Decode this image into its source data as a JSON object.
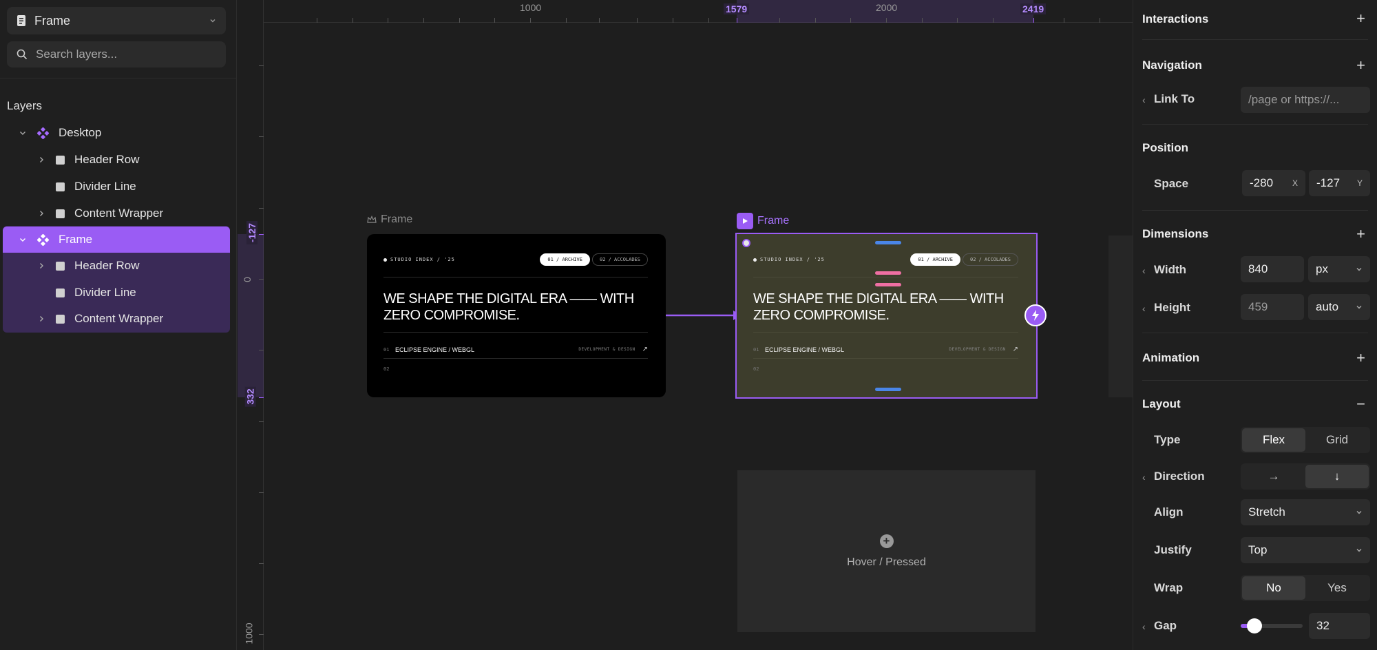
{
  "left": {
    "frame_select": "Frame",
    "search_placeholder": "Search layers...",
    "layers_title": "Layers",
    "layers": [
      {
        "label": "Desktop",
        "type": "component",
        "expanded": true
      },
      {
        "label": "Header Row",
        "type": "frame",
        "expandable": true
      },
      {
        "label": "Divider Line",
        "type": "frame",
        "expandable": false
      },
      {
        "label": "Content Wrapper",
        "type": "frame",
        "expandable": true
      },
      {
        "label": "Frame",
        "type": "component",
        "expanded": true,
        "selected": true
      },
      {
        "label": "Header Row",
        "type": "frame",
        "expandable": true
      },
      {
        "label": "Divider Line",
        "type": "frame",
        "expandable": false
      },
      {
        "label": "Content Wrapper",
        "type": "frame",
        "expandable": true
      }
    ]
  },
  "canvas": {
    "ruler_top": [
      "1000",
      "2000"
    ],
    "ruler_top_selection": [
      "1579",
      "2419"
    ],
    "ruler_left": [
      "0",
      "1000"
    ],
    "ruler_left_selection": [
      "-127",
      "332"
    ],
    "frame_a_label": "Frame",
    "frame_b_label": "Frame",
    "card": {
      "studio": "STUDIO INDEX / '25",
      "tab1": "01 / ARCHIVE",
      "tab2": "02 / ACCOLADES",
      "headline": "WE SHAPE THE DIGITAL ERA —— WITH ZERO COMPROMISE.",
      "row1_num": "01",
      "row1_title": "ECLIPSE ENGINE / WEBGL",
      "row1_cat": "DEVELOPMENT & DESIGN",
      "row1_arrow": "↗",
      "row2_num": "02"
    },
    "variant_label": "Hover / Pressed",
    "colors": {
      "accent": "#9a5cf4",
      "card_a_bg": "#000000",
      "card_b_bg": "#3d3d2c",
      "handle_blue": "#4a86e8",
      "handle_pink": "#ef6fa3"
    }
  },
  "right": {
    "interactions": "Interactions",
    "navigation": "Navigation",
    "link_to_label": "Link To",
    "link_to_placeholder": "/page or https://...",
    "position": "Position",
    "space_label": "Space",
    "x_value": "-280",
    "x_unit": "X",
    "y_value": "-127",
    "y_unit": "Y",
    "dimensions": "Dimensions",
    "width_label": "Width",
    "width_value": "840",
    "width_unit": "px",
    "height_label": "Height",
    "height_value": "459",
    "height_unit": "auto",
    "animation": "Animation",
    "layout": "Layout",
    "type_label": "Type",
    "type_options": [
      "Flex",
      "Grid"
    ],
    "direction_label": "Direction",
    "direction_options": [
      "→",
      "↓"
    ],
    "align_label": "Align",
    "align_value": "Stretch",
    "justify_label": "Justify",
    "justify_value": "Top",
    "wrap_label": "Wrap",
    "wrap_options": [
      "No",
      "Yes"
    ],
    "gap_label": "Gap",
    "gap_value": "32",
    "gap_slider_fraction": 0.1
  }
}
